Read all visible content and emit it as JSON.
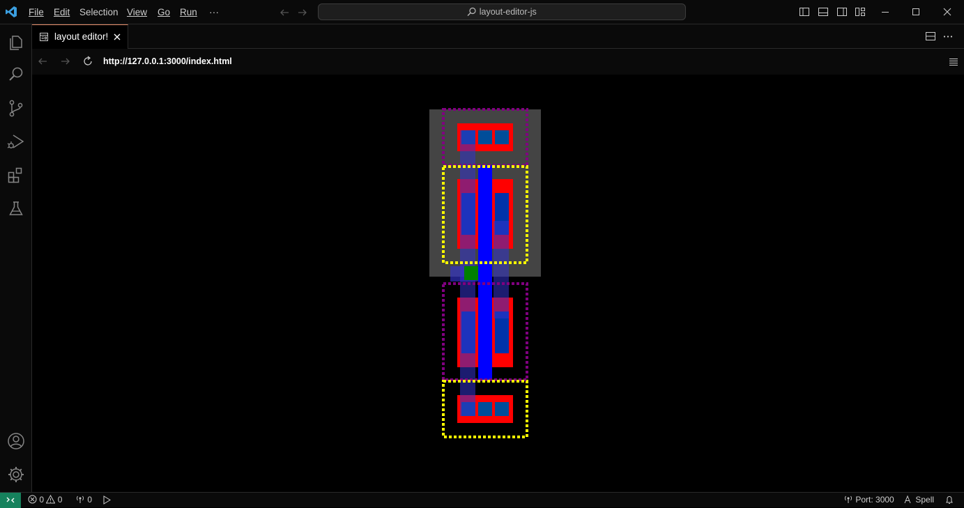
{
  "menu": {
    "items": [
      {
        "label": "File"
      },
      {
        "label": "Edit"
      },
      {
        "label": "Selection"
      },
      {
        "label": "View"
      },
      {
        "label": "Go"
      },
      {
        "label": "Run"
      }
    ],
    "more": "···"
  },
  "search": {
    "text": "layout-editor-js"
  },
  "tab": {
    "label": "layout editor!"
  },
  "browser": {
    "url": "http://127.0.0.1:3000/index.html"
  },
  "status": {
    "errors": "0",
    "warnings": "0",
    "ports": "0",
    "port": "Port: 3000",
    "spell": "Spell"
  },
  "colors": {
    "accent": "#e28a66",
    "remote": "#16825d",
    "nwell": "#444444",
    "diffusion": "#ff0000",
    "poly": "#0000ff",
    "contact": "#004d99",
    "tap": "#008000",
    "pmos_outline": "#800080",
    "nmos_outline": "#ffff00"
  },
  "icons": {
    "app": "vscode-logo-icon",
    "activity": [
      "explorer-icon",
      "search-icon",
      "source-control-icon",
      "run-debug-icon",
      "extensions-icon",
      "testing-icon",
      "accounts-icon",
      "manage-gear-icon"
    ]
  }
}
